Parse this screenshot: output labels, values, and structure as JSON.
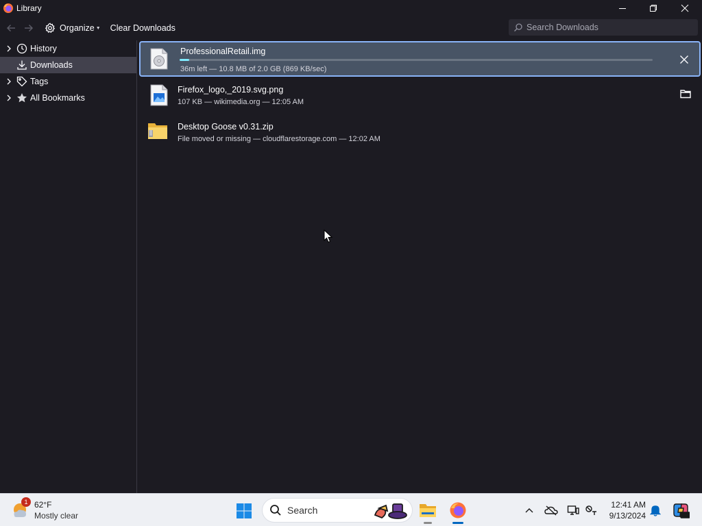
{
  "window": {
    "title": "Library",
    "controls": [
      "minimize",
      "restore",
      "close"
    ]
  },
  "toolbar": {
    "back_icon": "arrow-left-icon",
    "forward_icon": "arrow-right-icon",
    "organize_label": "Organize",
    "clear_downloads_label": "Clear Downloads",
    "search_placeholder": "Search Downloads"
  },
  "sidebar": {
    "items": [
      {
        "label": "History",
        "icon": "clock-icon",
        "expandable": true,
        "selected": false
      },
      {
        "label": "Downloads",
        "icon": "download-icon",
        "expandable": false,
        "selected": true
      },
      {
        "label": "Tags",
        "icon": "tag-icon",
        "expandable": true,
        "selected": false
      },
      {
        "label": "All Bookmarks",
        "icon": "star-icon",
        "expandable": true,
        "selected": false
      }
    ]
  },
  "downloads": [
    {
      "name": "ProfessionalRetail.img",
      "status": "36m left — 10.8 MB of 2.0 GB (869 KB/sec)",
      "progress": 0.005,
      "icon": "disc-image-file-icon",
      "action": "cancel-icon",
      "selected": true
    },
    {
      "name": "Firefox_logo,_2019.svg.png",
      "status": "107 KB — wikimedia.org — 12:05 AM",
      "icon": "image-file-icon",
      "action": "folder-icon",
      "selected": false
    },
    {
      "name": "Desktop Goose v0.31.zip",
      "status": "File moved or missing — cloudflarestorage.com — 12:02 AM",
      "icon": "zip-folder-icon",
      "action": "",
      "selected": false
    }
  ],
  "taskbar": {
    "weather": {
      "temp": "62°F",
      "desc": "Mostly clear",
      "badge": "1"
    },
    "search_label": "Search",
    "apps": [
      "file-explorer-icon",
      "firefox-icon"
    ],
    "tray": [
      "chevron-up-icon",
      "onedrive-offline-icon",
      "display-icon",
      "network-icon",
      "bell-icon",
      "copilot-icon"
    ],
    "time": "12:41 AM",
    "date": "9/13/2024"
  },
  "colors": {
    "window_bg": "#1c1b22",
    "selected_row": "#485465",
    "focus_ring": "#8ab4f8",
    "progress_fill": "#80ebff",
    "sidebar_selected": "#42414d",
    "taskbar_bg": "#eef0f4",
    "accent": "#0067c0"
  }
}
